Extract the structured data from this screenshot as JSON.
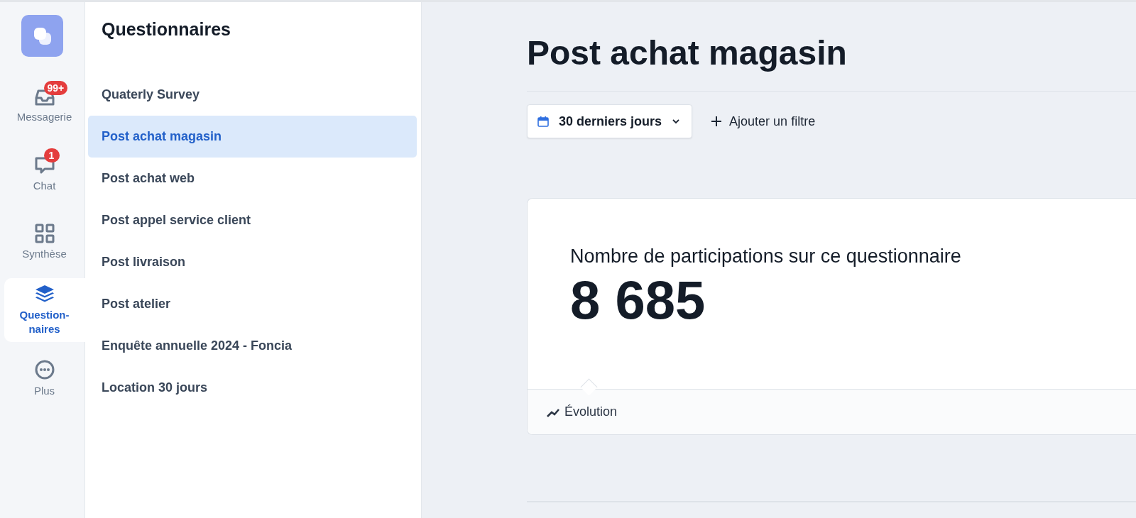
{
  "nav": [
    {
      "kind": "inbox",
      "label": "Messagerie",
      "badge": "99+",
      "selected": false
    },
    {
      "kind": "chat",
      "label": "Chat",
      "badge": "1",
      "selected": false
    },
    {
      "kind": "grid",
      "label": "Synthèse",
      "selected": false
    },
    {
      "kind": "layers",
      "label": "Question-\nnaires",
      "selected": true
    },
    {
      "kind": "more",
      "label": "Plus",
      "selected": false
    }
  ],
  "sidebar": {
    "title": "Questionnaires",
    "items": [
      {
        "label": "Quaterly Survey",
        "selected": false
      },
      {
        "label": "Post achat magasin",
        "selected": true
      },
      {
        "label": "Post achat web",
        "selected": false
      },
      {
        "label": "Post appel service client",
        "selected": false
      },
      {
        "label": "Post livraison",
        "selected": false
      },
      {
        "label": "Post atelier",
        "selected": false
      },
      {
        "label": "Enquête annuelle 2024 - Foncia",
        "selected": false
      },
      {
        "label": "Location 30 jours",
        "selected": false
      }
    ]
  },
  "page": {
    "title": "Post achat magasin",
    "date_filter": "30 derniers jours",
    "add_filter": "Ajouter un filtre",
    "metric": {
      "label": "Nombre de participations sur ce questionnaire",
      "value": "8 685",
      "footer": "Évolution"
    }
  }
}
